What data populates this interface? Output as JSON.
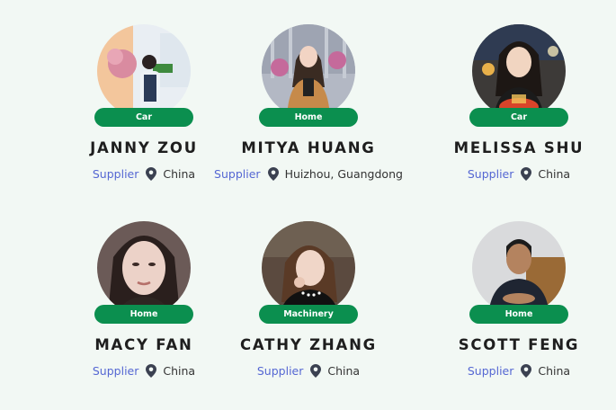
{
  "colors": {
    "background": "#f2f8f4",
    "pill": "#0b8f4f",
    "role": "#5567d3",
    "name": "#1e1e1e",
    "pin": "#3b4151"
  },
  "suppliers": [
    {
      "category": "Car",
      "name": "JANNY ZOU",
      "role": "Supplier",
      "location": "China",
      "location_icon": "map-pin-icon"
    },
    {
      "category": "Home",
      "name": "MITYA HUANG",
      "role": "Supplier",
      "location": "Huizhou, Guangdong",
      "location_icon": "map-pin-icon"
    },
    {
      "category": "Car",
      "name": "MELISSA SHU",
      "role": "Supplier",
      "location": "China",
      "location_icon": "map-pin-icon"
    },
    {
      "category": "Home",
      "name": "MACY FAN",
      "role": "Supplier",
      "location": "China",
      "location_icon": "map-pin-icon"
    },
    {
      "category": "Machinery",
      "name": "CATHY ZHANG",
      "role": "Supplier",
      "location": "China",
      "location_icon": "map-pin-icon"
    },
    {
      "category": "Home",
      "name": "SCOTT FENG",
      "role": "Supplier",
      "location": "China",
      "location_icon": "map-pin-icon"
    }
  ]
}
